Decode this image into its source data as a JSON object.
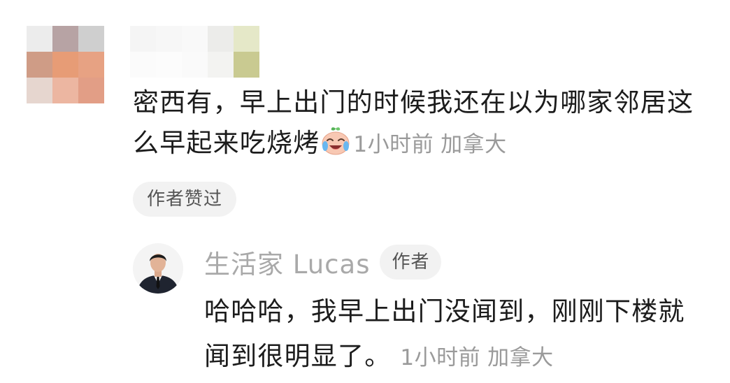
{
  "comment": {
    "text": "密西有，早上出门的时候我还在以为哪家邻居这么早起来吃烧烤",
    "emoji": "crying-laughing-face",
    "time": "1小时前",
    "location": "加拿大",
    "author_liked_label": "作者赞过"
  },
  "reply": {
    "author_name": "生活家 Lucas",
    "author_badge": "作者",
    "text": "哈哈哈，我早上出门没闻到，刚刚下楼就闻到很明显了。",
    "time": "1小时前",
    "location": "加拿大"
  },
  "colors": {
    "text_primary": "#1c1c1c",
    "text_meta": "#9a9a9a",
    "pill_background": "#f2f2f2",
    "reply_name": "#a9a9a9"
  }
}
